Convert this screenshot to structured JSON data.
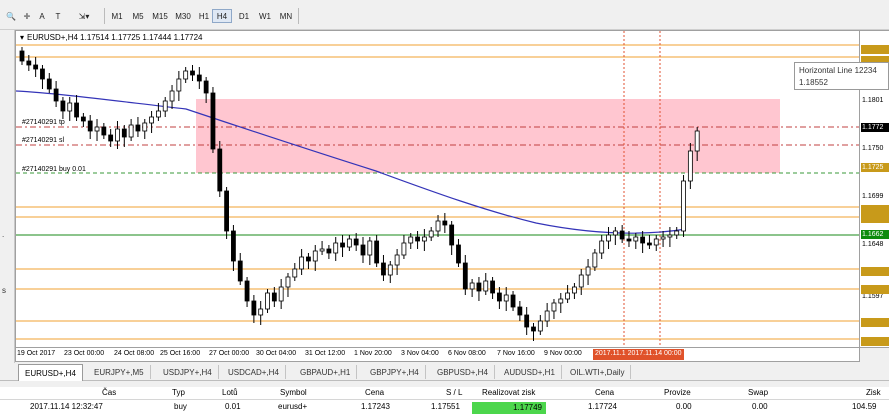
{
  "toolbar": {
    "timeframes": [
      "M1",
      "M5",
      "M15",
      "M30",
      "H1",
      "H4",
      "D1",
      "W1",
      "MN"
    ],
    "active_timeframe": "H4",
    "tools": [
      {
        "name": "crosshair-icon",
        "glyph": "✛"
      },
      {
        "name": "text-tool-icon",
        "glyph": "A"
      },
      {
        "name": "label-tool-icon",
        "glyph": "T"
      },
      {
        "name": "shapes-dropdown-icon",
        "glyph": "⇲▾"
      }
    ]
  },
  "chart": {
    "title": "EURUSD+,H4  1.17514 1.17725 1.17444 1.17724",
    "order_labels": {
      "tp": "#27140291 tp",
      "sl": "#27140291 sl",
      "buy": "#27140291 buy 0.01"
    },
    "tooltip": {
      "line1": "Horizontal Line 12234",
      "line2": "1.18552"
    },
    "zone_color": "#ffc0cb",
    "ma_color": "#3434b8",
    "up_color": "#ffffff",
    "down_color": "#000000"
  },
  "price_axis": {
    "labels": [
      {
        "text": "1.1801",
        "y": 1.1801
      },
      {
        "text": "1.1750",
        "y": 1.175
      },
      {
        "text": "1.1699",
        "y": 1.1699
      },
      {
        "text": "1.1648",
        "y": 1.1648
      },
      {
        "text": "1.1597",
        "y": 1.1597
      }
    ],
    "tags": [
      {
        "text": "1.1772",
        "color": "#000000"
      },
      {
        "text": "1.1662",
        "color": "#0c8a0c"
      },
      {
        "text": "1.1725",
        "color": "#c89a1a"
      }
    ]
  },
  "time_axis": {
    "labels": [
      "19 Oct 2017",
      "23 Oct 00:00",
      "24 Oct 08:00",
      "25 Oct 16:00",
      "27 Oct 00:00",
      "30 Oct 04:00",
      "31 Oct 12:00",
      "1 Nov 20:00",
      "3 Nov 04:00",
      "6 Nov 08:00",
      "7 Nov 16:00",
      "9 Nov 00:00"
    ],
    "highlight": "2017.11.1  2017.11.14 00:00"
  },
  "left_strip": {
    "marks": [
      "s",
      "."
    ]
  },
  "tabs": [
    {
      "label": "EURUSD+,H4",
      "active": true
    },
    {
      "label": "EURJPY+,M5",
      "active": false
    },
    {
      "label": "USDJPY+,H4",
      "active": false
    },
    {
      "label": "USDCAD+,H4",
      "active": false
    },
    {
      "label": "GBPAUD+,H1",
      "active": false
    },
    {
      "label": "GBPJPY+,H4",
      "active": false
    },
    {
      "label": "GBPUSD+,H4",
      "active": false
    },
    {
      "label": "AUDUSD+,H1",
      "active": false
    },
    {
      "label": "OIL.WTI+,Daily",
      "active": false
    }
  ],
  "terminal": {
    "headers": [
      "Čas",
      "Typ",
      "Lotů",
      "Symbol",
      "Cena",
      "S / L",
      "Realizovat zisk",
      "Cena",
      "Provize",
      "Swap",
      "Zisk"
    ],
    "row": [
      "2017.11.14 12:32:47",
      "buy",
      "0.01",
      "eurusd+",
      "1.17243",
      "1.17551",
      "1.17749",
      "1.17724",
      "0.00",
      "0.00",
      "104.59"
    ],
    "profit_color": "#4cd64c"
  }
}
